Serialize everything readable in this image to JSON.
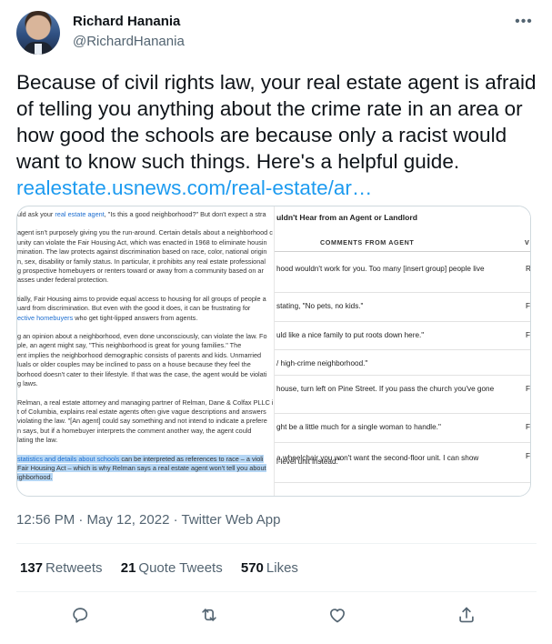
{
  "author": {
    "name": "Richard Hanania",
    "handle": "@RichardHanania"
  },
  "tweet": {
    "text": "Because of civil rights law, your real estate agent is afraid of telling you anything about the crime rate in an area or how good the schools are because only a racist would want to know such things. Here's a helpful guide.",
    "link": "realestate.usnews.com/real-estate/ar…"
  },
  "image": {
    "left_lines": [
      [
        {
          "t": "uld ask your "
        },
        {
          "t": "real estate agent",
          "c": "blue"
        },
        {
          "t": ", \"Is this a good neighborhood?\" But don't expect a stra"
        }
      ],
      [
        {
          "t": "agent isn't purposely giving you the run-around. Certain details about a neighborhood c"
        },
        {
          "br": true
        },
        {
          "t": "unity can violate the Fair Housing Act, which was enacted in 1968 to eliminate housin"
        },
        {
          "br": true
        },
        {
          "t": "mination. The law protects against discrimination based on race, color, national origin"
        },
        {
          "br": true
        },
        {
          "t": "n, sex, disability or family status. In particular, it prohibits any real estate professional"
        },
        {
          "br": true
        },
        {
          "t": "g prospective homebuyers or renters toward or away from a community based on ar"
        },
        {
          "br": true
        },
        {
          "t": "asses under federal protection."
        }
      ],
      [
        {
          "t": "tially, Fair Housing aims to provide equal access to housing for all groups of people a"
        },
        {
          "br": true
        },
        {
          "t": "uard from discrimination. But even with the good it does, it can be frustrating for"
        },
        {
          "br": true
        },
        {
          "t": "ective homebuyers",
          "c": "blue"
        },
        {
          "t": " who get tight-lipped answers from agents."
        }
      ],
      [
        {
          "t": "g an opinion about a neighborhood, even done unconsciously, can violate the law. Fo"
        },
        {
          "br": true
        },
        {
          "t": "ple, an agent might say, \"This neighborhood is great for young families.\" The"
        },
        {
          "br": true
        },
        {
          "t": "ent implies the neighborhood demographic consists of parents and kids. Unmarried"
        },
        {
          "br": true
        },
        {
          "t": "luals or older couples may be inclined to pass on a house because they feel the"
        },
        {
          "br": true
        },
        {
          "t": "borhood doesn't cater to their lifestyle. If that was the case, the agent would be violati"
        },
        {
          "br": true
        },
        {
          "t": "g laws."
        }
      ],
      [
        {
          "t": "Relman, a real estate attorney and managing partner of Relman, Dane & Colfax PLLC i"
        },
        {
          "br": true
        },
        {
          "t": "t of Columbia, explains real estate agents often give vague descriptions and answers"
        },
        {
          "br": true
        },
        {
          "t": "violating the law. \"[An agent] could say something and not intend to indicate a prefere"
        },
        {
          "br": true
        },
        {
          "t": "n says, but if a homebuyer interprets the comment another way, the agent could"
        },
        {
          "br": true
        },
        {
          "t": "lating the law."
        }
      ],
      [
        {
          "t": "statistics and details about schools",
          "c": "blue hl"
        },
        {
          "t": " can be interpreted as references to race – a violi",
          "c": "hl"
        },
        {
          "br": true
        },
        {
          "t": " Fair Housing Act – which is why Relman says a real estate agent won't tell you about",
          "c": "hl"
        },
        {
          "br": true
        },
        {
          "t": "ighborhood.",
          "c": "hl"
        }
      ]
    ],
    "right_title": "uldn't Hear from an Agent or Landlord",
    "right_col_header": "COMMENTS FROM AGENT",
    "right_col_header2": "V",
    "right_rows": [
      {
        "text": "hood wouldn't work for you. Too many [insert group] people live",
        "r": "R"
      },
      {
        "text": " stating, \"No pets, no kids.\"",
        "r": "F"
      },
      {
        "text": "uld like a nice family to put roots down here.\"",
        "r": "F"
      },
      {
        "text": "/ high-crime neighborhood.\"",
        "r": ""
      },
      {
        "text": "house, turn left on Pine Street. If you pass the church you've gone",
        "r": "F"
      },
      {
        "text": "ght be a little much for a single woman to handle.\"",
        "r": "F"
      },
      {
        "text": " a wheelchair you won't want the second-floor unit. I can show",
        "r": "F"
      },
      {
        "text": "l-level unit instead.\"",
        "r": ""
      }
    ]
  },
  "meta": {
    "text": "12:56 PM · May 12, 2022 · Twitter Web App"
  },
  "stats": {
    "retweets_count": "137",
    "retweets_label": "Retweets",
    "quotes_count": "21",
    "quotes_label": "Quote Tweets",
    "likes_count": "570",
    "likes_label": "Likes"
  },
  "icons": {
    "more": "more-horizontal-icon",
    "reply": "reply-icon",
    "retweet": "retweet-icon",
    "like": "heart-icon",
    "share": "share-icon"
  },
  "colors": {
    "link": "#1d9bf0",
    "secondary_text": "#536471",
    "primary_text": "#0f1419"
  }
}
